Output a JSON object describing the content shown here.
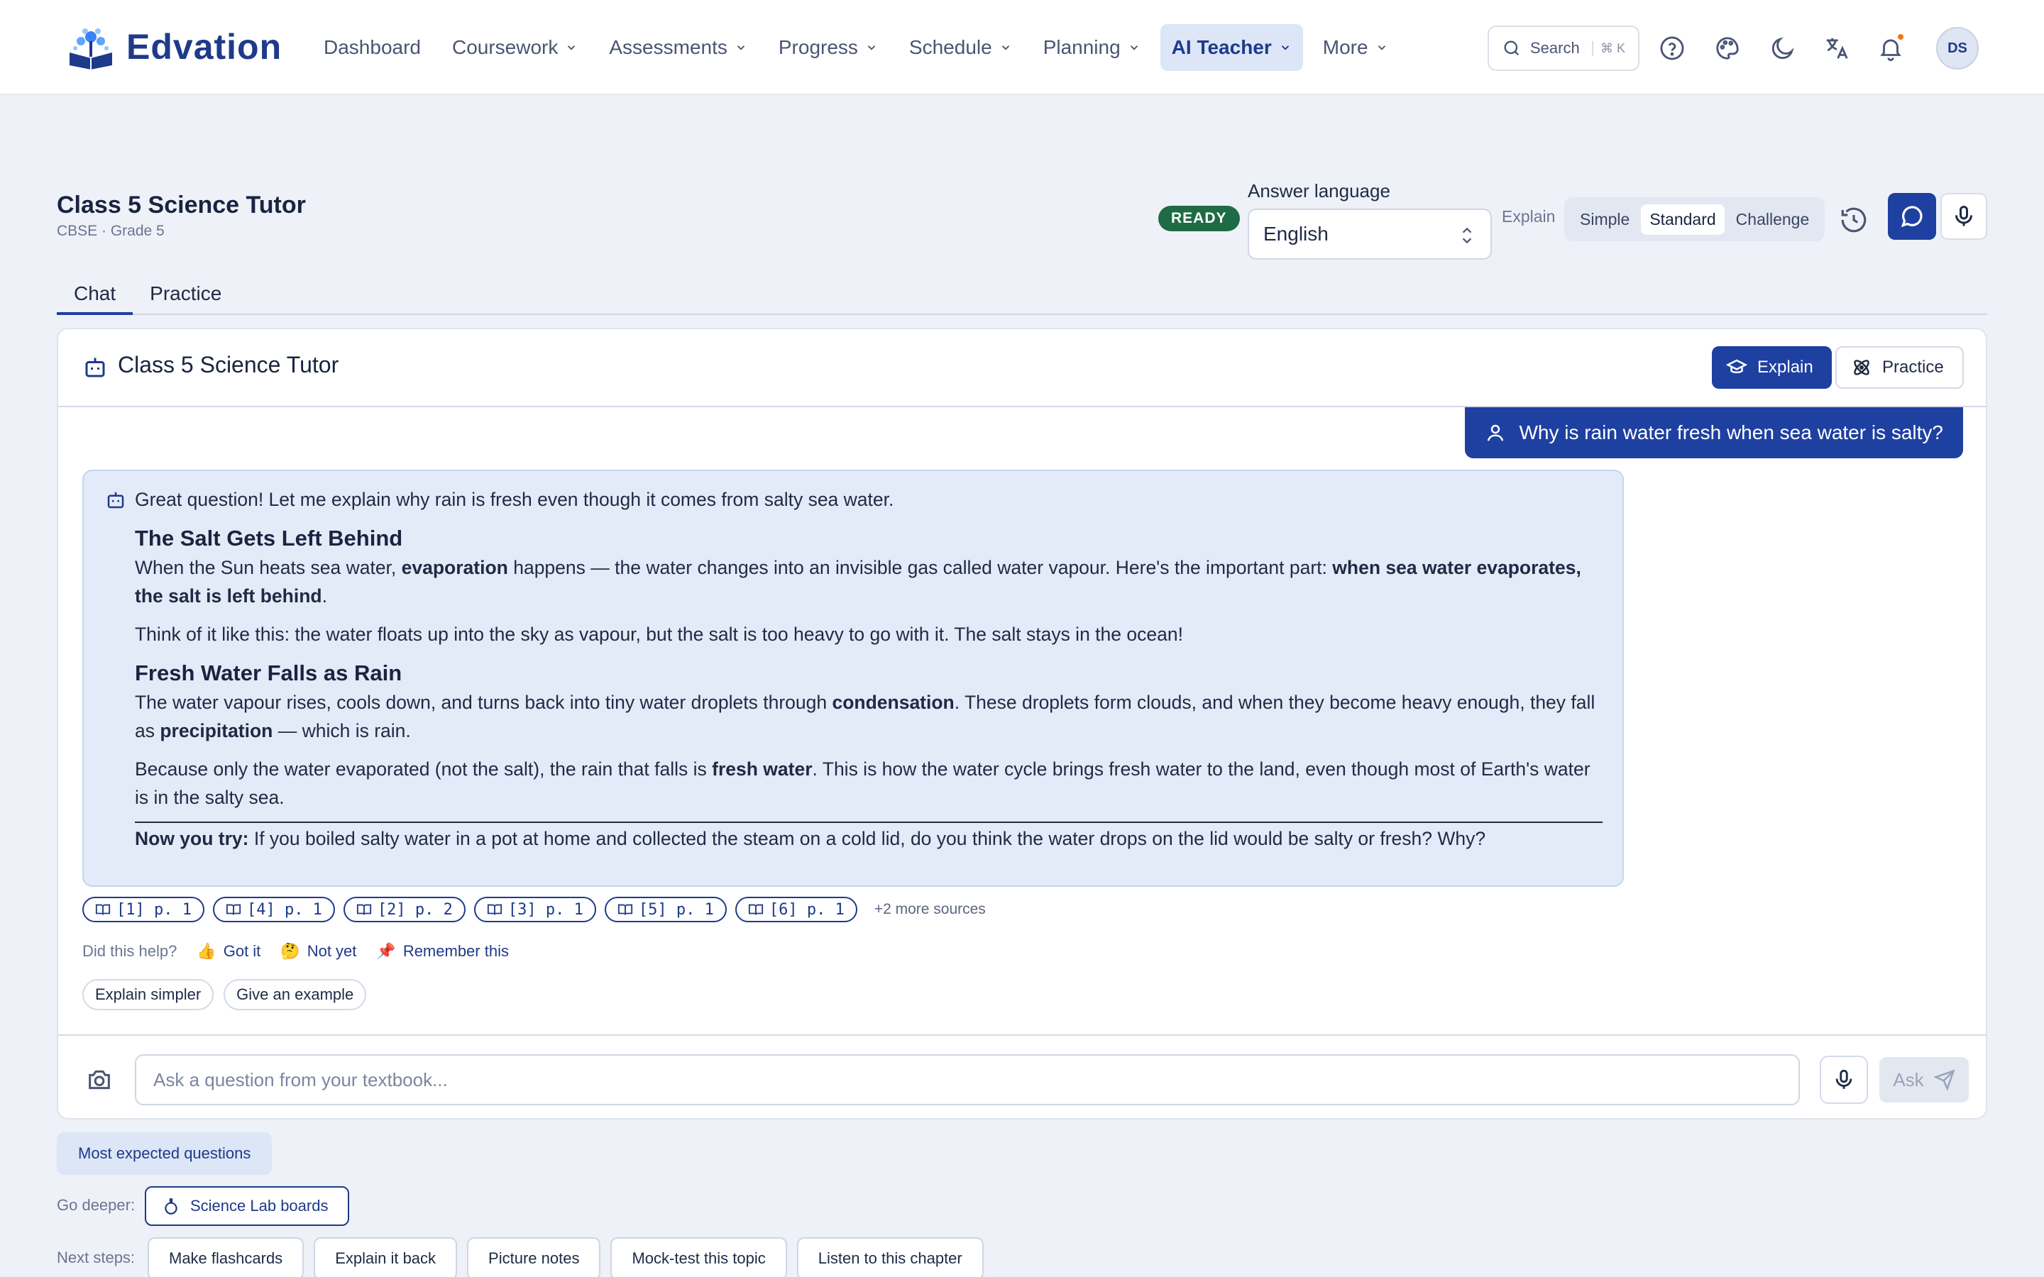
{
  "brand": {
    "name": "Edvation"
  },
  "nav": {
    "items": [
      {
        "label": "Dashboard",
        "dropdown": false,
        "active": false
      },
      {
        "label": "Coursework",
        "dropdown": true,
        "active": false
      },
      {
        "label": "Assessments",
        "dropdown": true,
        "active": false
      },
      {
        "label": "Progress",
        "dropdown": true,
        "active": false
      },
      {
        "label": "Schedule",
        "dropdown": true,
        "active": false
      },
      {
        "label": "Planning",
        "dropdown": true,
        "active": false
      },
      {
        "label": "AI Teacher",
        "dropdown": true,
        "active": true
      },
      {
        "label": "More",
        "dropdown": true,
        "active": false
      }
    ],
    "search_label": "Search",
    "search_shortcut": "⌘ K",
    "avatar_initials": "DS"
  },
  "header": {
    "title": "Class 5 Science Tutor",
    "subtitle": "CBSE · Grade 5",
    "status": "READY",
    "language_label": "Answer language",
    "language_value": "English",
    "explain_label": "Explain",
    "explain_levels": [
      "Simple",
      "Standard",
      "Challenge"
    ],
    "explain_selected": "Standard"
  },
  "tabs": [
    "Chat",
    "Practice"
  ],
  "chat": {
    "title": "Class 5 Science Tutor",
    "explain_button": "Explain",
    "practice_button": "Practice",
    "user_message": "Why is rain water fresh when sea water is salty?",
    "ai_intro": "Great question! Let me explain why rain is fresh even though it comes from salty sea water.",
    "section1_heading": "The Salt Gets Left Behind",
    "s1p1_a": "When the Sun heats sea water, ",
    "s1p1_b": "evaporation",
    "s1p1_c": " happens — the water changes into an invisible gas called water vapour. Here's the important part: ",
    "s1p1_d": "when sea water evaporates, the salt is left behind",
    "s1p1_e": ".",
    "s1p2": "Think of it like this: the water floats up into the sky as vapour, but the salt is too heavy to go with it. The salt stays in the ocean!",
    "section2_heading": "Fresh Water Falls as Rain",
    "s2p1_a": "The water vapour rises, cools down, and turns back into tiny water droplets through ",
    "s2p1_b": "condensation",
    "s2p1_c": ". These droplets form clouds, and when they become heavy enough, they fall as ",
    "s2p1_d": "precipitation",
    "s2p1_e": " — which is rain.",
    "s2p2_a": "Because only the water evaporated (not the salt), the rain that falls is ",
    "s2p2_b": "fresh water",
    "s2p2_c": ". This is how the water cycle brings fresh water to the land, even though most of Earth's water is in the salty sea.",
    "try_label": "Now you try:",
    "try_text": " If you boiled salty water in a pot at home and collected the steam on a cold lid, do you think the water drops on the lid would be salty or fresh? Why?",
    "sources": [
      "[1] p. 1",
      "[4] p. 1",
      "[2] p. 2",
      "[3] p. 1",
      "[5] p. 1",
      "[6] p. 1"
    ],
    "more_sources": "+2 more sources",
    "feedback_label": "Did this help?",
    "feedback_got_it": "Got it",
    "feedback_not_yet": "Not yet",
    "feedback_remember": "Remember this",
    "followups": [
      "Explain simpler",
      "Give an example"
    ],
    "input_placeholder": "Ask a question from your textbook...",
    "ask_button": "Ask"
  },
  "bottom": {
    "most_expected": "Most expected questions",
    "go_deeper_label": "Go deeper:",
    "go_deeper_button": "Science Lab boards",
    "next_steps_label": "Next steps:",
    "next_steps": [
      "Make flashcards",
      "Explain it back",
      "Picture notes",
      "Mock-test this topic",
      "Listen to this chapter"
    ]
  },
  "colors": {
    "primary": "#1e40a0",
    "ready": "#1f6b45",
    "bubble": "#e3eaf8",
    "background": "#eef1f7"
  }
}
